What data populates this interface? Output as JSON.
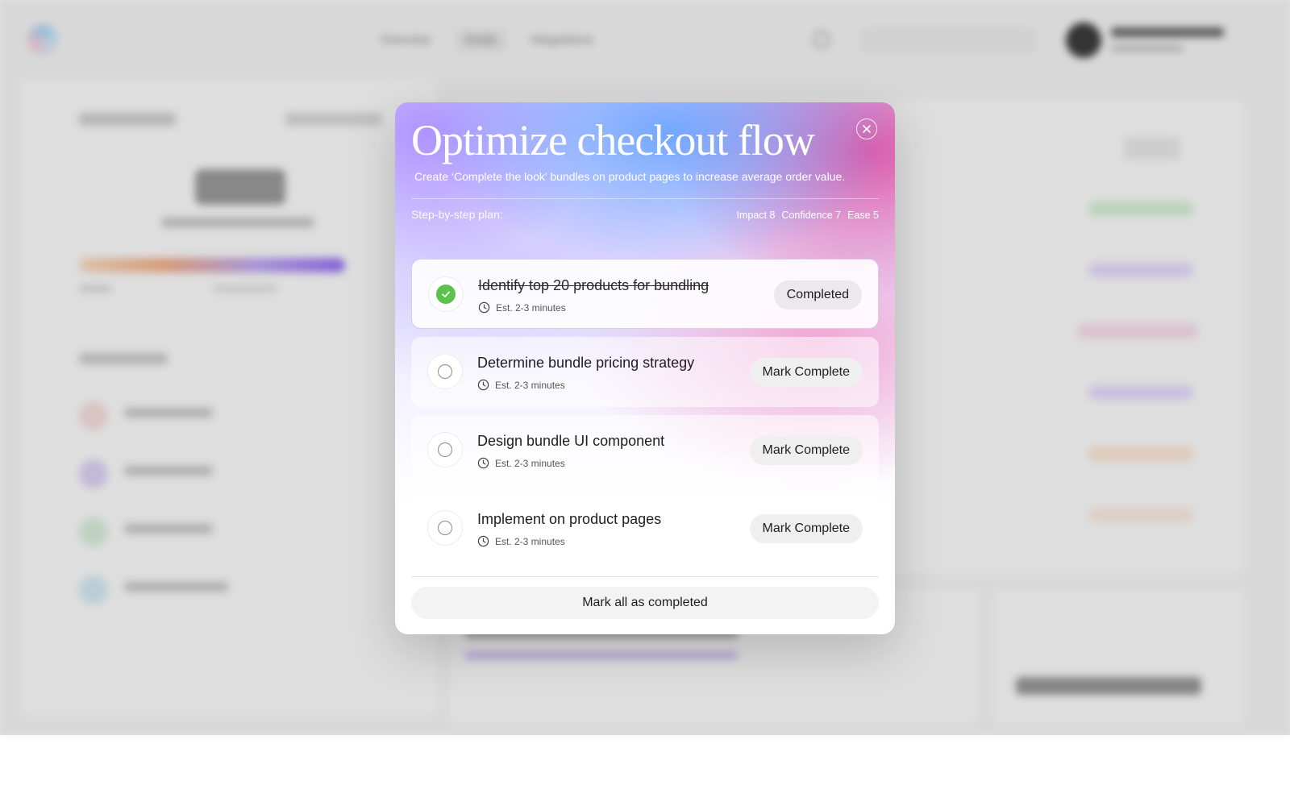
{
  "background_app": {
    "nav_items": [
      "Overview",
      "Goals",
      "Integrations"
    ]
  },
  "modal": {
    "title": "Optimize checkout flow",
    "subtitle": "Create ‘Complete the look’ bundles on product pages to increase average order value.",
    "plan_label": "Step-by-step plan:",
    "metrics": {
      "impact": "Impact 8",
      "confidence": "Confidence 7",
      "ease": "Ease 5"
    },
    "steps": [
      {
        "name": "Identify top 20 products for bundling",
        "estimate": "Est. 2-3 minutes",
        "action": "Completed",
        "completed": true
      },
      {
        "name": "Determine bundle pricing strategy",
        "estimate": "Est. 2-3 minutes",
        "action": "Mark Complete",
        "completed": false
      },
      {
        "name": "Design bundle UI component",
        "estimate": "Est. 2-3 minutes",
        "action": "Mark Complete",
        "completed": false
      },
      {
        "name": "Implement on product pages",
        "estimate": "Est. 2-3 minutes",
        "action": "Mark Complete",
        "completed": false
      }
    ],
    "mark_all_label": "Mark all as completed"
  },
  "colors": {
    "check_green": "#5cc24d",
    "gradient_blue": "#60a0ff",
    "gradient_pink": "#e252a0",
    "gradient_violet": "#aa8cff"
  }
}
